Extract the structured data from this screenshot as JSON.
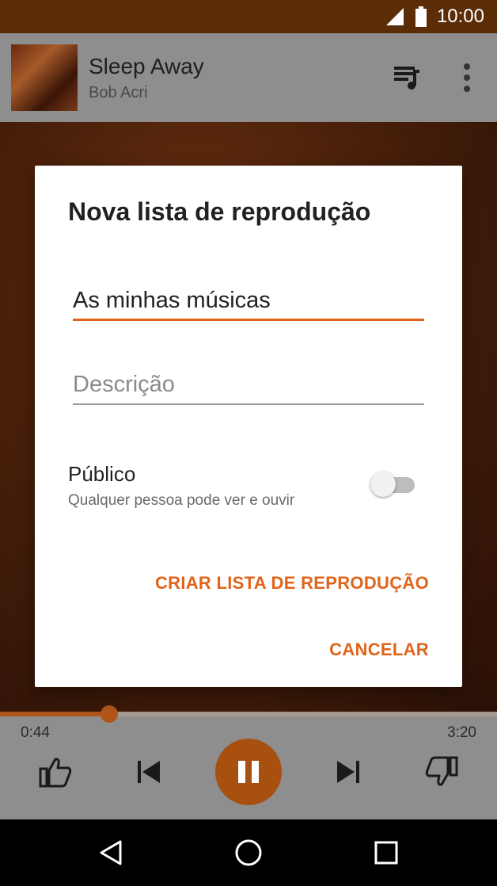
{
  "status_bar": {
    "time": "10:00",
    "icons": [
      "signal-icon",
      "battery-icon"
    ]
  },
  "now_playing": {
    "title": "Sleep Away",
    "artist": "Bob Acri",
    "icons": [
      "queue-icon",
      "more-vert-icon"
    ]
  },
  "player": {
    "elapsed": "0:44",
    "total": "3:20",
    "progress_fraction": 0.22,
    "icons": [
      "thumb-up-icon",
      "skip-previous-icon",
      "pause-icon",
      "skip-next-icon",
      "thumb-down-icon"
    ]
  },
  "dialog": {
    "title": "Nova lista de reprodução",
    "name_value": "As minhas músicas",
    "description_placeholder": "Descrição",
    "public_label": "Público",
    "public_sublabel": "Qualquer pessoa pode ver e ouvir",
    "public_enabled": false,
    "create_label": "CRIAR LISTA DE REPRODUÇÃO",
    "cancel_label": "CANCELAR"
  },
  "nav_bar": {
    "icons": [
      "back-icon",
      "home-icon",
      "recents-icon"
    ]
  },
  "colors": {
    "accent": "#e0641a",
    "status_bar": "#5a2d07",
    "player_button": "#a8500f"
  }
}
